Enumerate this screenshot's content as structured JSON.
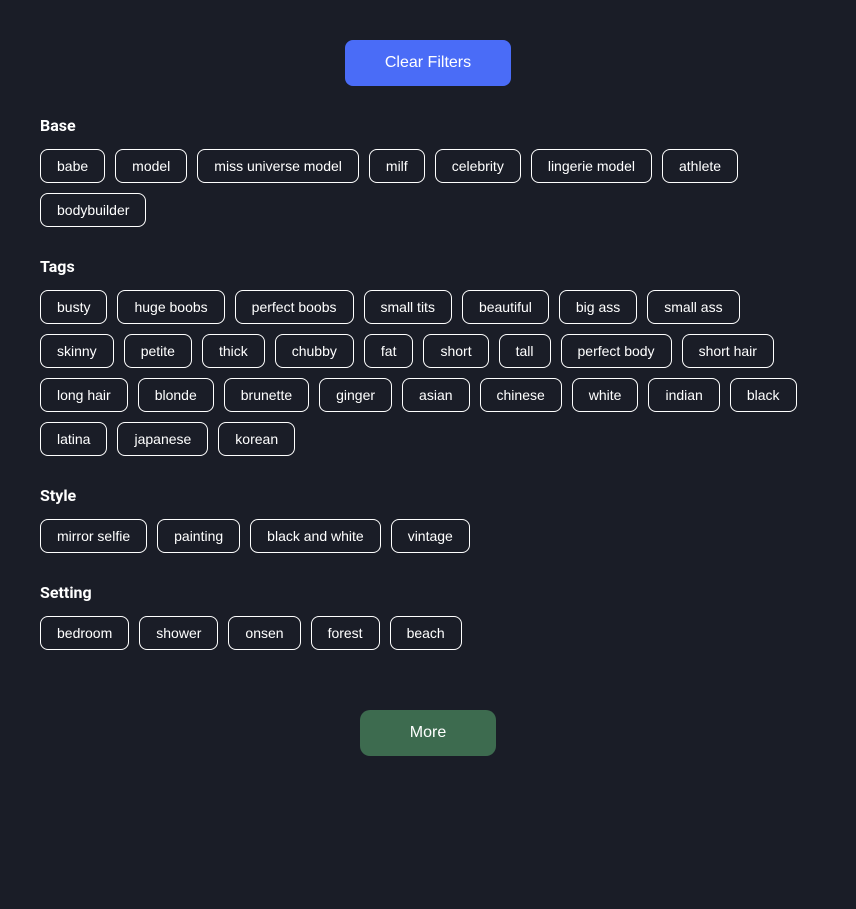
{
  "header": {
    "clear_filters_label": "Clear Filters"
  },
  "sections": [
    {
      "id": "base",
      "title": "Base",
      "tags": [
        "babe",
        "model",
        "miss universe model",
        "milf",
        "celebrity",
        "lingerie model",
        "athlete",
        "bodybuilder"
      ]
    },
    {
      "id": "tags",
      "title": "Tags",
      "tags": [
        "busty",
        "huge boobs",
        "perfect boobs",
        "small tits",
        "beautiful",
        "big ass",
        "small ass",
        "skinny",
        "petite",
        "thick",
        "chubby",
        "fat",
        "short",
        "tall",
        "perfect body",
        "short hair",
        "long hair",
        "blonde",
        "brunette",
        "ginger",
        "asian",
        "chinese",
        "white",
        "indian",
        "black",
        "latina",
        "japanese",
        "korean"
      ]
    },
    {
      "id": "style",
      "title": "Style",
      "tags": [
        "mirror selfie",
        "painting",
        "black and white",
        "vintage"
      ]
    },
    {
      "id": "setting",
      "title": "Setting",
      "tags": [
        "bedroom",
        "shower",
        "onsen",
        "forest",
        "beach"
      ]
    }
  ],
  "footer": {
    "more_label": "More"
  }
}
